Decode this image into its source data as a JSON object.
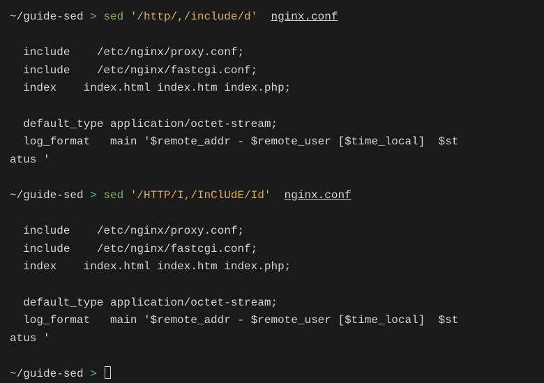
{
  "blocks": [
    {
      "prompt": {
        "path": "~/guide-sed",
        "symbol": ">",
        "cmd": "sed",
        "arg": "'/http/,/include/d'",
        "file": "nginx.conf"
      },
      "output": [
        "",
        "  include    /etc/nginx/proxy.conf;",
        "  include    /etc/nginx/fastcgi.conf;",
        "  index    index.html index.htm index.php;",
        "",
        "  default_type application/octet-stream;",
        "  log_format   main '$remote_addr - $remote_user [$time_local]  $st",
        "atus '",
        ""
      ]
    },
    {
      "prompt": {
        "path": "~/guide-sed",
        "symbol": ">",
        "cmd": "sed",
        "arg": "'/HTTP/I,/InClUdE/Id'",
        "file": "nginx.conf"
      },
      "output": [
        "",
        "  include    /etc/nginx/proxy.conf;",
        "  include    /etc/nginx/fastcgi.conf;",
        "  index    index.html index.htm index.php;",
        "",
        "  default_type application/octet-stream;",
        "  log_format   main '$remote_addr - $remote_user [$time_local]  $st",
        "atus '",
        ""
      ]
    }
  ],
  "final_prompt": {
    "path": "~/guide-sed",
    "symbol": ">"
  }
}
